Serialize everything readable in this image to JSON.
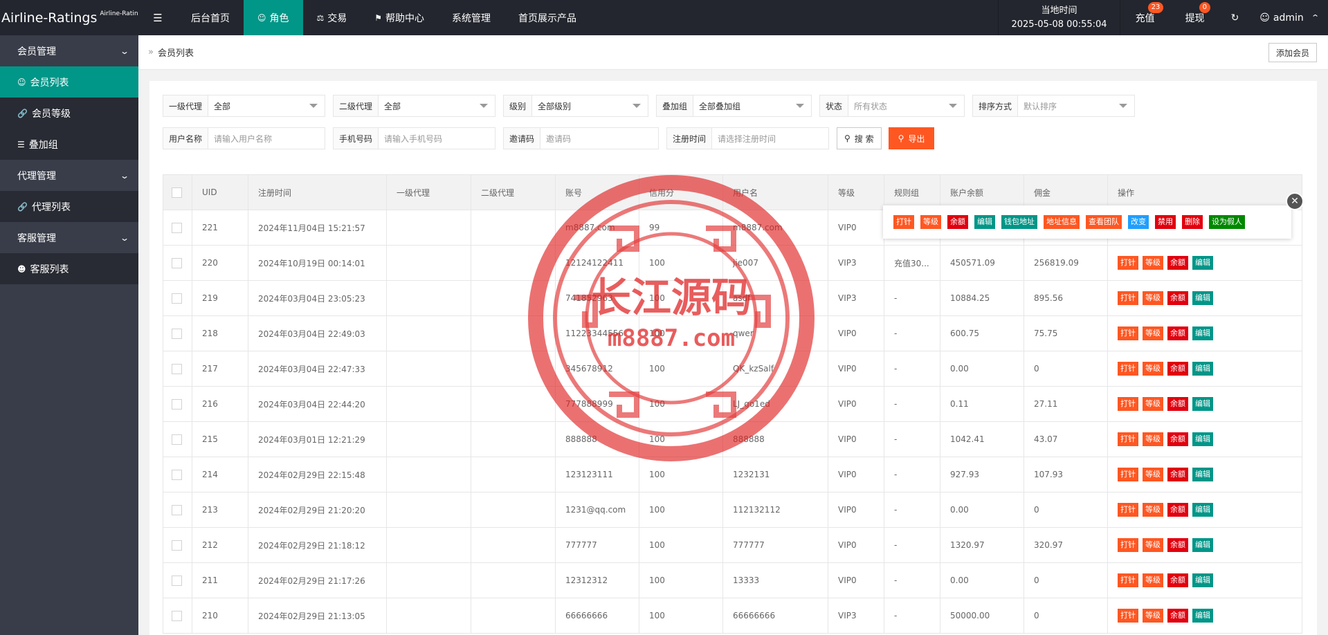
{
  "app": {
    "title": "Airline-Ratings",
    "subtitle": "Airline-Ratings"
  },
  "topnav": {
    "items": [
      {
        "label": "后台首页",
        "icon": ""
      },
      {
        "label": "角色",
        "icon": "user-icon",
        "active": true
      },
      {
        "label": "交易",
        "icon": "scale-icon"
      },
      {
        "label": "帮助中心",
        "icon": "flag-icon"
      },
      {
        "label": "系统管理",
        "icon": ""
      },
      {
        "label": "首页展示产品",
        "icon": ""
      }
    ],
    "clock_label": "当地时间",
    "clock_value": "2025-05-08 00:55:04",
    "recharge": "充值",
    "recharge_badge": "23",
    "withdraw": "提现",
    "withdraw_badge": "0",
    "admin": "admin"
  },
  "sidebar": {
    "groups": [
      {
        "label": "会员管理",
        "items": [
          "会员列表",
          "会员等级",
          "叠加组"
        ]
      },
      {
        "label": "代理管理",
        "items": [
          "代理列表"
        ]
      },
      {
        "label": "客服管理",
        "items": [
          "客服列表"
        ]
      }
    ]
  },
  "breadcrumb": "会员列表",
  "add_button": "添加会员",
  "filters": {
    "agent1": {
      "label": "一级代理",
      "value": "全部"
    },
    "agent2": {
      "label": "二级代理",
      "value": "全部"
    },
    "level": {
      "label": "级别",
      "value": "全部级别"
    },
    "group": {
      "label": "叠加组",
      "value": "全部叠加组"
    },
    "status": {
      "label": "状态",
      "placeholder": "所有状态"
    },
    "sort": {
      "label": "排序方式",
      "placeholder": "默认排序"
    },
    "username": {
      "label": "用户名称",
      "placeholder": "请输入用户名称"
    },
    "phone": {
      "label": "手机号码",
      "placeholder": "请输入手机号码"
    },
    "invite": {
      "label": "邀请码",
      "placeholder": "邀请码"
    },
    "regtime": {
      "label": "注册时间",
      "placeholder": "请选择注册时间"
    },
    "search_btn": "搜 索",
    "export_btn": "导出"
  },
  "table": {
    "headers": [
      "UID",
      "注册时间",
      "一级代理",
      "二级代理",
      "账号",
      "信用分",
      "用户名",
      "等级",
      "规则组",
      "账户余额",
      "佣金",
      "操作"
    ],
    "rows": [
      {
        "uid": "221",
        "time": "2024年11月04日 15:21:57",
        "a1": "",
        "a2": "",
        "account": "m8887.com",
        "credit": "99",
        "username": "m8887.com",
        "level": "VIP0",
        "rule": "",
        "balance": "",
        "commission": ""
      },
      {
        "uid": "220",
        "time": "2024年10月19日 00:14:01",
        "a1": "",
        "a2": "",
        "account": "12124122411",
        "credit": "100",
        "username": "jie007",
        "level": "VIP3",
        "rule": "充值30...",
        "balance": "450571.09",
        "commission": "256819.09"
      },
      {
        "uid": "219",
        "time": "2024年03月04日 23:05:23",
        "a1": "",
        "a2": "",
        "account": "741852963",
        "credit": "100",
        "username": "asdf",
        "level": "VIP3",
        "rule": "-",
        "balance": "10884.25",
        "commission": "895.56"
      },
      {
        "uid": "218",
        "time": "2024年03月04日 22:49:03",
        "a1": "",
        "a2": "",
        "account": "11223344556",
        "credit": "100",
        "username": "qwer",
        "level": "VIP0",
        "rule": "-",
        "balance": "600.75",
        "commission": "75.75"
      },
      {
        "uid": "217",
        "time": "2024年03月04日 22:47:33",
        "a1": "",
        "a2": "",
        "account": "345678912",
        "credit": "100",
        "username": "QK_kzSalf",
        "level": "VIP0",
        "rule": "-",
        "balance": "0.00",
        "commission": "0"
      },
      {
        "uid": "216",
        "time": "2024年03月04日 22:44:20",
        "a1": "",
        "a2": "",
        "account": "777888999",
        "credit": "100",
        "username": "LJ_go1ed",
        "level": "VIP0",
        "rule": "-",
        "balance": "0.11",
        "commission": "27.11"
      },
      {
        "uid": "215",
        "time": "2024年03月01日 12:21:29",
        "a1": "",
        "a2": "",
        "account": "888888",
        "credit": "100",
        "username": "888888",
        "level": "VIP0",
        "rule": "-",
        "balance": "1042.41",
        "commission": "43.07"
      },
      {
        "uid": "214",
        "time": "2024年02月29日 22:15:48",
        "a1": "",
        "a2": "",
        "account": "123123111",
        "credit": "100",
        "username": "1232131",
        "level": "VIP0",
        "rule": "-",
        "balance": "927.93",
        "commission": "107.93"
      },
      {
        "uid": "213",
        "time": "2024年02月29日 21:20:20",
        "a1": "",
        "a2": "",
        "account": "1231@qq.com",
        "credit": "100",
        "username": "112132112",
        "level": "VIP0",
        "rule": "-",
        "balance": "0.00",
        "commission": "0"
      },
      {
        "uid": "212",
        "time": "2024年02月29日 21:18:12",
        "a1": "",
        "a2": "",
        "account": "777777",
        "credit": "100",
        "username": "777777",
        "level": "VIP0",
        "rule": "-",
        "balance": "1320.97",
        "commission": "320.97"
      },
      {
        "uid": "211",
        "time": "2024年02月29日 21:17:26",
        "a1": "",
        "a2": "",
        "account": "12312312",
        "credit": "100",
        "username": "13333",
        "level": "VIP0",
        "rule": "-",
        "balance": "0.00",
        "commission": "0"
      },
      {
        "uid": "210",
        "time": "2024年02月29日 21:13:05",
        "a1": "",
        "a2": "",
        "account": "66666666",
        "credit": "100",
        "username": "66666666",
        "level": "VIP3",
        "rule": "-",
        "balance": "50000.00",
        "commission": "0"
      }
    ],
    "row_ops": [
      "打针",
      "等级",
      "余额",
      "编辑"
    ],
    "popup_ops": [
      "打针",
      "等级",
      "余额",
      "编辑",
      "钱包地址",
      "地址信息",
      "查看团队",
      "改变",
      "禁用",
      "删除",
      "设为假人"
    ]
  },
  "watermark": {
    "cn": "长江源码",
    "url": "m8887.com"
  },
  "colors": {
    "dark": "#23262e",
    "sidebar": "#393d49",
    "accent": "#009688",
    "orange": "#ff5722",
    "red": "#e1000e",
    "blue": "#1e9fff",
    "green": "#008800",
    "stamp": "#e02020"
  }
}
